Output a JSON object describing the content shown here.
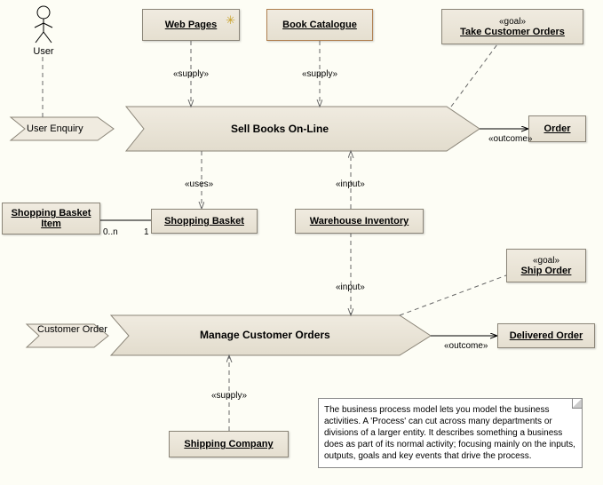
{
  "actor": {
    "name": "User"
  },
  "nodes": {
    "webPages": "Web Pages",
    "bookCatalogue": "Book Catalogue",
    "takeOrders": {
      "stereo": "«goal»",
      "title": "Take Customer Orders"
    },
    "order": "Order",
    "shoppingBasketItem": "Shopping Basket Item",
    "shoppingBasket": "Shopping Basket",
    "warehouseInventory": "Warehouse Inventory",
    "shipOrder": {
      "stereo": "«goal»",
      "title": "Ship Order"
    },
    "deliveredOrder": "Delivered Order",
    "shippingCompany": "Shipping Company"
  },
  "processes": {
    "sellBooks": "Sell Books On-Line",
    "manageOrders": "Manage Customer Orders"
  },
  "events": {
    "userEnquiry": "User Enquiry",
    "customerOrder": "Customer Order"
  },
  "labels": {
    "supply": "«supply»",
    "uses": "«uses»",
    "input": "«input»",
    "outcome": "«outcome»",
    "mult0n": "0..n",
    "mult1": "1"
  },
  "note": "The business process model lets you model the business activities. A 'Process' can cut across many departments or divisions of a larger entity. It describes something a business does as part of its normal activity; focusing mainly on the inputs, outputs, goals and key events that drive the process.",
  "chart_data": {
    "type": "uml-business-process",
    "actors": [
      "User"
    ],
    "processes": [
      "Sell Books On-Line",
      "Manage Customer Orders"
    ],
    "objects": [
      "Web Pages",
      "Book Catalogue",
      "Take Customer Orders",
      "Order",
      "Shopping Basket Item",
      "Shopping Basket",
      "Warehouse Inventory",
      "Ship Order",
      "Delivered Order",
      "Shipping Company"
    ],
    "events": [
      "User Enquiry",
      "Customer Order"
    ],
    "relationships": [
      {
        "from": "User",
        "to": "User Enquiry",
        "type": "dependency"
      },
      {
        "from": "User Enquiry",
        "to": "Sell Books On-Line",
        "type": "event"
      },
      {
        "from": "Web Pages",
        "to": "Sell Books On-Line",
        "type": "supply"
      },
      {
        "from": "Book Catalogue",
        "to": "Sell Books On-Line",
        "type": "supply"
      },
      {
        "from": "Sell Books On-Line",
        "to": "Take Customer Orders",
        "type": "goal"
      },
      {
        "from": "Sell Books On-Line",
        "to": "Order",
        "type": "outcome"
      },
      {
        "from": "Sell Books On-Line",
        "to": "Shopping Basket",
        "type": "uses"
      },
      {
        "from": "Shopping Basket Item",
        "to": "Shopping Basket",
        "type": "association",
        "multiplicity": "0..n — 1"
      },
      {
        "from": "Warehouse Inventory",
        "to": "Sell Books On-Line",
        "type": "input"
      },
      {
        "from": "Warehouse Inventory",
        "to": "Manage Customer Orders",
        "type": "input"
      },
      {
        "from": "Customer Order",
        "to": "Manage Customer Orders",
        "type": "event"
      },
      {
        "from": "Manage Customer Orders",
        "to": "Ship Order",
        "type": "goal"
      },
      {
        "from": "Manage Customer Orders",
        "to": "Delivered Order",
        "type": "outcome"
      },
      {
        "from": "Shipping Company",
        "to": "Manage Customer Orders",
        "type": "supply"
      }
    ]
  }
}
